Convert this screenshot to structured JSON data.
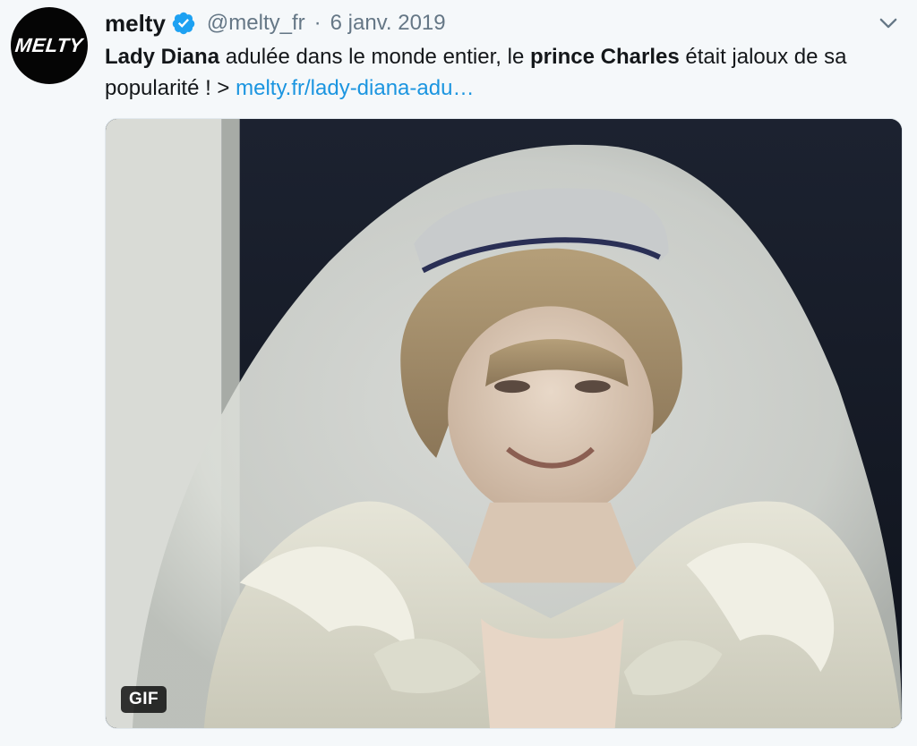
{
  "author": {
    "avatar_text": "MELTY",
    "display_name": "melty",
    "handle": "@melty_fr",
    "separator": "·",
    "timestamp": "6 janv. 2019"
  },
  "tweet": {
    "name1": "Lady Diana",
    "text1": " adulée dans le monde entier, le ",
    "name2": "prince Charles",
    "text2": " était jaloux de sa popularité ! > ",
    "link": "melty.fr/lady-diana-adu…"
  },
  "media": {
    "badge": "GIF"
  },
  "colors": {
    "link": "#1b95e0",
    "verified": "#1da1f2",
    "meta": "#657786",
    "background": "#f5f8fa"
  },
  "icons": {
    "verified": "verified-badge-icon",
    "caret": "chevron-down-icon"
  }
}
